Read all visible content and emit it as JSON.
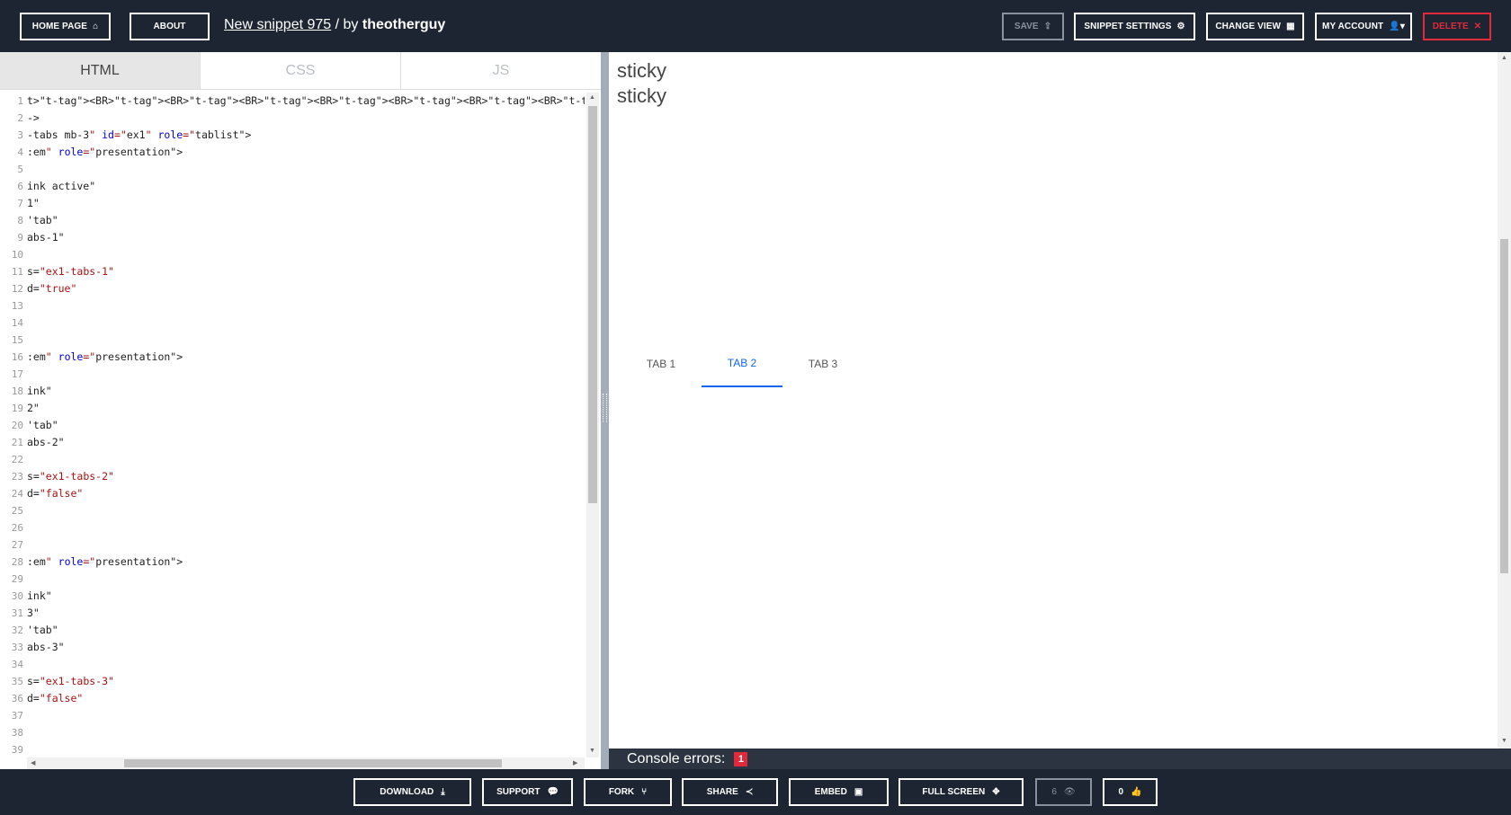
{
  "header": {
    "home_label": "HOME PAGE",
    "about_label": "ABOUT",
    "snippet_title": "New snippet 975",
    "by_text": " / by ",
    "author": "theotherguy",
    "save_label": "SAVE",
    "settings_label": "SNIPPET SETTINGS",
    "change_view_label": "CHANGE VIEW",
    "account_label": "MY ACCOUNT",
    "delete_label": "DELETE"
  },
  "editor": {
    "tabs": [
      "HTML",
      "CSS",
      "JS"
    ],
    "active_tab": "HTML",
    "line_numbers": [
      "1",
      "2",
      "3",
      "4",
      "5",
      "6",
      "7",
      "8",
      "9",
      "10",
      "11",
      "12",
      "13",
      "14",
      "15",
      "16",
      "17",
      "18",
      "19",
      "20",
      "21",
      "22",
      "23",
      "24",
      "25",
      "26",
      "27",
      "28",
      "29",
      "30",
      "31",
      "32",
      "33",
      "34",
      "35",
      "36",
      "37",
      "38",
      "39"
    ],
    "lines": [
      "t><BR><BR><BR><BR><BR><BR><BR><BR><BR><BR><BR><BR><BR><BR><BR><BR><BR><BR><BR><BR><BR><B",
      "->",
      "-tabs mb-3\" id=\"ex1\" role=\"tablist\">",
      ":em\" role=\"presentation\">",
      "",
      "ink active\"",
      "1\"",
      "'tab\"",
      "abs-1\"",
      "",
      "s=\"ex1-tabs-1\"",
      "d=\"true\"",
      "",
      "",
      "",
      ":em\" role=\"presentation\">",
      "",
      "ink\"",
      "2\"",
      "'tab\"",
      "abs-2\"",
      "",
      "s=\"ex1-tabs-2\"",
      "d=\"false\"",
      "",
      "",
      "",
      ":em\" role=\"presentation\">",
      "",
      "ink\"",
      "3\"",
      "'tab\"",
      "abs-3\"",
      "",
      "s=\"ex1-tabs-3\"",
      "d=\"false\"",
      "",
      "",
      ""
    ]
  },
  "preview": {
    "sticky_lines": [
      "sticky",
      "sticky"
    ],
    "tabs": [
      "TAB 1",
      "TAB 2",
      "TAB 3"
    ],
    "active_tab": "TAB 2"
  },
  "console": {
    "label": "Console errors:",
    "count": "1"
  },
  "footer": {
    "download_label": "DOWNLOAD",
    "support_label": "SUPPORT",
    "fork_label": "FORK",
    "share_label": "SHARE",
    "embed_label": "EMBED",
    "fullscreen_label": "FULL SCREEN",
    "views_count": "6",
    "likes_count": "0"
  },
  "colors": {
    "bar_bg": "#1d2533",
    "danger": "#e02a3b",
    "tab_active": "#1266f1"
  }
}
